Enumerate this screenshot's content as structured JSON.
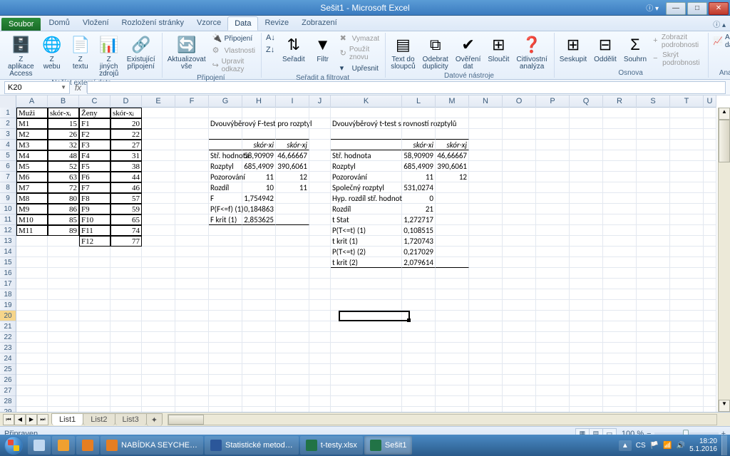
{
  "app": {
    "title": "Sešit1 - Microsoft Excel"
  },
  "tabs": {
    "file": "Soubor",
    "items": [
      "Domů",
      "Vložení",
      "Rozložení stránky",
      "Vzorce",
      "Data",
      "Revize",
      "Zobrazení"
    ],
    "active": 4
  },
  "ribbon": {
    "g1": {
      "label": "Načíst externí data",
      "access": "Z aplikace Access",
      "web": "Z webu",
      "text": "Z textu",
      "other": "Z jiných zdrojů",
      "exist": "Existující připojení"
    },
    "g2": {
      "label": "Připojení",
      "refresh": "Aktualizovat vše",
      "conn": "Připojení",
      "prop": "Vlastnosti",
      "links": "Upravit odkazy"
    },
    "g3": {
      "label": "Seřadit a filtrovat",
      "az": "A↓Z",
      "za": "Z↓A",
      "sort": "Seřadit",
      "filter": "Filtr",
      "clear": "Vymazat",
      "reapply": "Použít znovu",
      "adv": "Upřesnit"
    },
    "g4": {
      "label": "Datové nástroje",
      "ttc": "Text do sloupců",
      "dup": "Odebrat duplicity",
      "val": "Ověření dat",
      "cons": "Sloučit",
      "what": "Citlivostní analýza"
    },
    "g5": {
      "label": "Osnova",
      "group": "Seskupit",
      "ungroup": "Oddělit",
      "subtotal": "Souhrn",
      "show": "Zobrazit podrobnosti",
      "hide": "Skrýt podrobnosti"
    },
    "g6": {
      "label": "Analýza",
      "anal": "Analýza dat"
    }
  },
  "namebox": "K20",
  "cols": [
    "A",
    "B",
    "C",
    "D",
    "E",
    "F",
    "G",
    "H",
    "I",
    "J",
    "K",
    "L",
    "M",
    "N",
    "O",
    "P",
    "Q",
    "R",
    "S",
    "T",
    "U"
  ],
  "data": {
    "A1": "Muži",
    "B1": "skór-xᵢ",
    "C1": "Ženy",
    "D1": "skór-xⱼ",
    "A2": "M1",
    "B2": "15",
    "C2": "F1",
    "D2": "20",
    "A3": "M2",
    "B3": "26",
    "C3": "F2",
    "D3": "22",
    "A4": "M3",
    "B4": "32",
    "C4": "F3",
    "D4": "27",
    "A5": "M4",
    "B5": "48",
    "C5": "F4",
    "D5": "31",
    "A6": "M5",
    "B6": "52",
    "C6": "F5",
    "D6": "38",
    "A7": "M6",
    "B7": "63",
    "C7": "F6",
    "D7": "44",
    "A8": "M7",
    "B8": "72",
    "C8": "F7",
    "D8": "46",
    "A9": "M8",
    "B9": "80",
    "C9": "F8",
    "D9": "57",
    "A10": "M9",
    "B10": "86",
    "C10": "F9",
    "D10": "59",
    "A11": "M10",
    "B11": "85",
    "C11": "F10",
    "D11": "65",
    "A12": "M11",
    "B12": "89",
    "C12": "F11",
    "D12": "74",
    "C13": "F12",
    "D13": "77",
    "G2": "Dvouvýběrový F-test pro rozptyl",
    "H4": "skór-xi",
    "I4": "skór-xj",
    "G5": "Stř. hodnota",
    "H5": "58,90909",
    "I5": "46,66667",
    "G6": "Rozptyl",
    "H6": "685,4909",
    "I6": "390,6061",
    "G7": "Pozorování",
    "H7": "11",
    "I7": "12",
    "G8": "Rozdíl",
    "H8": "10",
    "I8": "11",
    "G9": "F",
    "H9": "1,754942",
    "G10": "P(F<=f) (1)",
    "H10": "0,184863",
    "G11": "F krit (1)",
    "H11": "2,853625",
    "K2": "Dvouvýběrový t-test s rovností rozptylů",
    "L4": "skór-xi",
    "M4": "skór-xj",
    "K5": "Stř. hodnota",
    "L5": "58,90909",
    "M5": "46,66667",
    "K6": "Rozptyl",
    "L6": "685,4909",
    "M6": "390,6061",
    "K7": "Pozorování",
    "L7": "11",
    "M7": "12",
    "K8": "Společný rozptyl",
    "L8": "531,0274",
    "K9": "Hyp. rozdíl stř. hodnot",
    "L9": "0",
    "K10": "Rozdíl",
    "L10": "21",
    "K11": "t Stat",
    "L11": "1,272717",
    "K12": "P(T<=t) (1)",
    "L12": "0,108515",
    "K13": "t krit (1)",
    "L13": "1,720743",
    "K14": "P(T<=t) (2)",
    "L14": "0,217029",
    "K15": "t krit (2)",
    "L15": "2,079614"
  },
  "sheets": {
    "items": [
      "List1",
      "List2",
      "List3"
    ],
    "active": 0
  },
  "status": {
    "ready": "Připraven",
    "zoom": "100 %"
  },
  "taskbar": {
    "items": [
      {
        "label": "",
        "icon": "#c0d8f0"
      },
      {
        "label": "",
        "icon": "#f0a030"
      },
      {
        "label": "",
        "icon": "#e67e22"
      },
      {
        "label": "NABÍDKA SEYCHE…",
        "icon": "#e67e22"
      },
      {
        "label": "Statistické metod…",
        "icon": "#2b579a"
      },
      {
        "label": "t-testy.xlsx",
        "icon": "#217346"
      },
      {
        "label": "Sešit1",
        "icon": "#217346",
        "active": true
      }
    ],
    "lang": "CS",
    "time": "18:20",
    "date": "5.1.2016"
  },
  "chart_data": {
    "type": "table",
    "tables": [
      {
        "title": "Dvouvýběrový F-test pro rozptyl",
        "columns": [
          "",
          "skór-xi",
          "skór-xj"
        ],
        "rows": [
          [
            "Stř. hodnota",
            58.90909,
            46.66667
          ],
          [
            "Rozptyl",
            685.4909,
            390.6061
          ],
          [
            "Pozorování",
            11,
            12
          ],
          [
            "Rozdíl",
            10,
            11
          ],
          [
            "F",
            1.754942,
            null
          ],
          [
            "P(F<=f) (1)",
            0.184863,
            null
          ],
          [
            "F krit (1)",
            2.853625,
            null
          ]
        ]
      },
      {
        "title": "Dvouvýběrový t-test s rovností rozptylů",
        "columns": [
          "",
          "skór-xi",
          "skór-xj"
        ],
        "rows": [
          [
            "Stř. hodnota",
            58.90909,
            46.66667
          ],
          [
            "Rozptyl",
            685.4909,
            390.6061
          ],
          [
            "Pozorování",
            11,
            12
          ],
          [
            "Společný rozptyl",
            531.0274,
            null
          ],
          [
            "Hyp. rozdíl stř. hodnot",
            0,
            null
          ],
          [
            "Rozdíl",
            21,
            null
          ],
          [
            "t Stat",
            1.272717,
            null
          ],
          [
            "P(T<=t) (1)",
            0.108515,
            null
          ],
          [
            "t krit (1)",
            1.720743,
            null
          ],
          [
            "P(T<=t) (2)",
            0.217029,
            null
          ],
          [
            "t krit (2)",
            2.079614,
            null
          ]
        ]
      }
    ],
    "raw_data": {
      "Muži": {
        "M1": 15,
        "M2": 26,
        "M3": 32,
        "M4": 48,
        "M5": 52,
        "M6": 63,
        "M7": 72,
        "M8": 80,
        "M9": 86,
        "M10": 85,
        "M11": 89
      },
      "Ženy": {
        "F1": 20,
        "F2": 22,
        "F3": 27,
        "F4": 31,
        "F5": 38,
        "F6": 44,
        "F7": 46,
        "F8": 57,
        "F9": 59,
        "F10": 65,
        "F11": 74,
        "F12": 77
      }
    }
  }
}
